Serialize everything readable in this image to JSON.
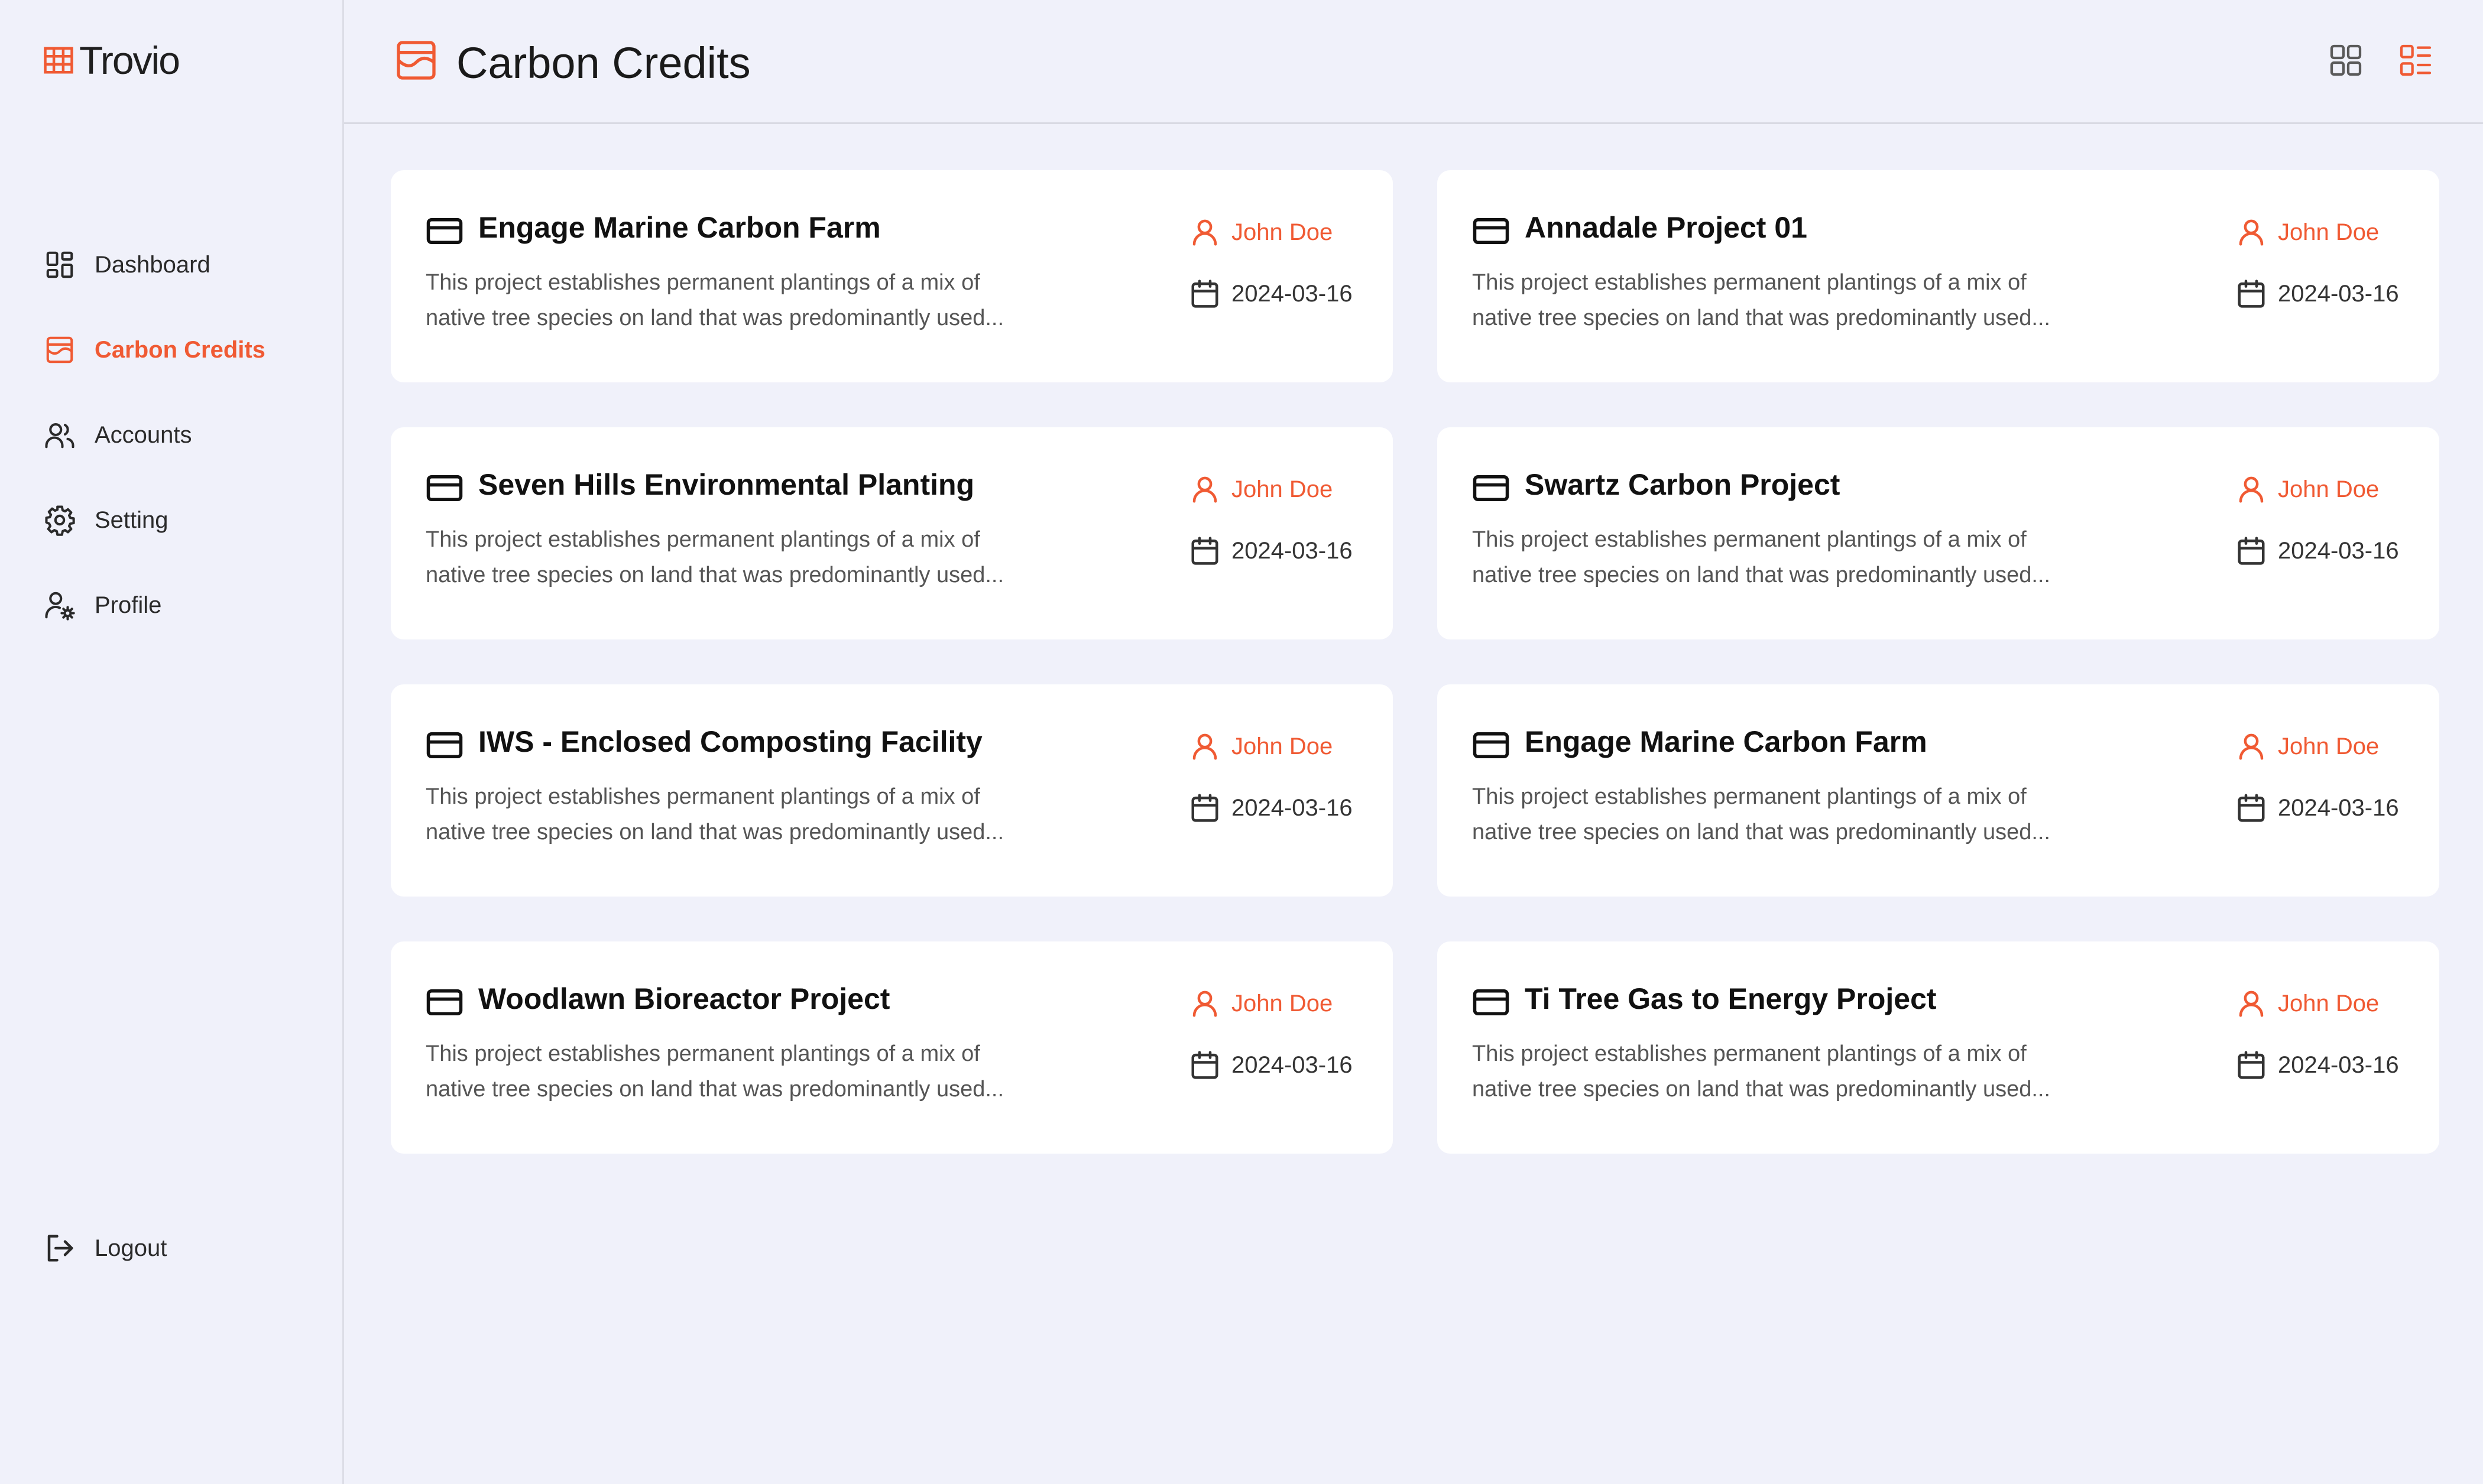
{
  "app": {
    "name": "Trovio"
  },
  "sidebar": {
    "items": [
      {
        "label": "Dashboard",
        "icon": "dashboard-icon",
        "active": false
      },
      {
        "label": "Carbon Credits",
        "icon": "carbon-credits-icon",
        "active": true
      },
      {
        "label": "Accounts",
        "icon": "users-icon",
        "active": false
      },
      {
        "label": "Setting",
        "icon": "gear-icon",
        "active": false
      },
      {
        "label": "Profile",
        "icon": "user-gear-icon",
        "active": false
      }
    ],
    "logout_label": "Logout"
  },
  "header": {
    "title": "Carbon Credits",
    "view_modes": [
      "grid",
      "list"
    ],
    "active_view": "list"
  },
  "colors": {
    "accent": "#f05a33",
    "background": "#f0f1fa",
    "card": "#ffffff"
  },
  "cards": [
    {
      "title": "Engage Marine Carbon Farm",
      "desc_line1": "This project establishes permanent plantings of a mix of",
      "desc_line2": "native tree species on land that was predominantly used...",
      "author": "John Doe",
      "date": "2024-03-16"
    },
    {
      "title": "Annadale Project 01",
      "desc_line1": "This project establishes permanent plantings of a mix of",
      "desc_line2": "native tree species on land that was predominantly used...",
      "author": "John Doe",
      "date": "2024-03-16"
    },
    {
      "title": "Seven Hills Environmental Planting",
      "desc_line1": "This project establishes permanent plantings of a mix of",
      "desc_line2": "native tree species on land that was predominantly used...",
      "author": "John Doe",
      "date": "2024-03-16"
    },
    {
      "title": "Swartz Carbon Project",
      "desc_line1": "This project establishes permanent plantings of a mix of",
      "desc_line2": "native tree species on land that was predominantly used...",
      "author": "John Doe",
      "date": "2024-03-16"
    },
    {
      "title": "IWS - Enclosed Composting Facility",
      "desc_line1": "This project establishes permanent plantings of a mix of",
      "desc_line2": "native tree species on land that was predominantly used...",
      "author": "John Doe",
      "date": "2024-03-16"
    },
    {
      "title": "Engage Marine Carbon Farm",
      "desc_line1": "This project establishes permanent plantings of a mix of",
      "desc_line2": "native tree species on land that was predominantly used...",
      "author": "John Doe",
      "date": "2024-03-16"
    },
    {
      "title": "Woodlawn Bioreactor Project",
      "desc_line1": "This project establishes permanent plantings of a mix of",
      "desc_line2": "native tree species on land that was predominantly used...",
      "author": "John Doe",
      "date": "2024-03-16"
    },
    {
      "title": "Ti Tree Gas to Energy Project",
      "desc_line1": "This project establishes permanent plantings of a mix of",
      "desc_line2": "native tree species on land that was predominantly used...",
      "author": "John Doe",
      "date": "2024-03-16"
    }
  ]
}
